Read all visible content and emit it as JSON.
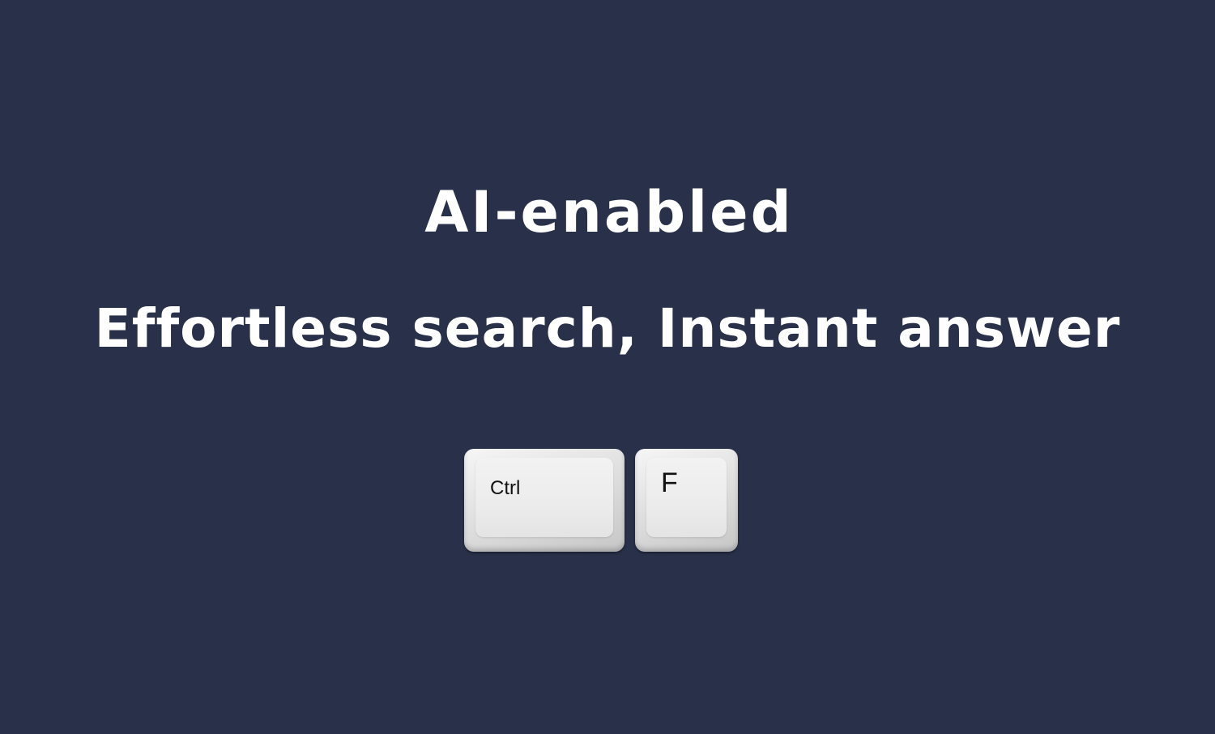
{
  "headline": {
    "line1": "AI-enabled",
    "line2": "Effortless search, Instant answer"
  },
  "shortcut": {
    "keys": [
      {
        "label": "Ctrl"
      },
      {
        "label": "F"
      }
    ]
  },
  "colors": {
    "background": "#29314a",
    "text": "#ffffff",
    "key_face": "#ececec",
    "key_label": "#111111"
  }
}
